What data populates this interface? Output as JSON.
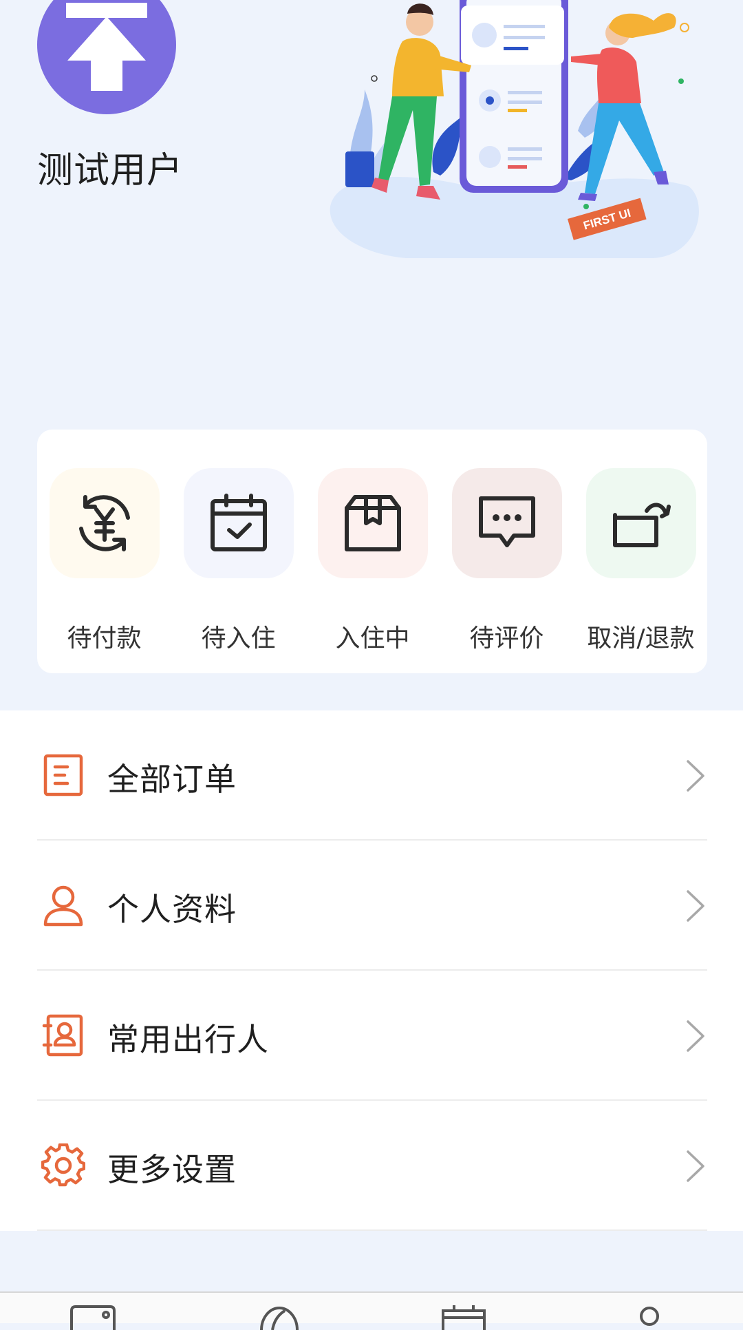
{
  "profile": {
    "username": "测试用户",
    "avatar_icon": "upload-arrow-icon",
    "illustration_text": "FIRST UI"
  },
  "orders": [
    {
      "label": "待付款",
      "icon": "yuan-refresh-icon",
      "bg": "#fffaef"
    },
    {
      "label": "待入住",
      "icon": "calendar-check-icon",
      "bg": "#f3f5fd"
    },
    {
      "label": "入住中",
      "icon": "package-box-icon",
      "bg": "#fdf1ef"
    },
    {
      "label": "待评价",
      "icon": "comment-dots-icon",
      "bg": "#f5eae9"
    },
    {
      "label": "取消/退款",
      "icon": "return-arrow-icon",
      "bg": "#eef9f1"
    }
  ],
  "menu": [
    {
      "label": "全部订单",
      "icon": "document-list-icon"
    },
    {
      "label": "个人资料",
      "icon": "user-icon"
    },
    {
      "label": "常用出行人",
      "icon": "contact-book-icon"
    },
    {
      "label": "更多设置",
      "icon": "gear-icon"
    }
  ],
  "tabbar": {
    "items": [
      "wallet-icon",
      "discover-icon",
      "calendar-icon",
      "profile-icon"
    ]
  },
  "colors": {
    "accent": "#e6683c",
    "avatar_bg": "#7b6de0",
    "page_bg": "#eef3fc"
  }
}
